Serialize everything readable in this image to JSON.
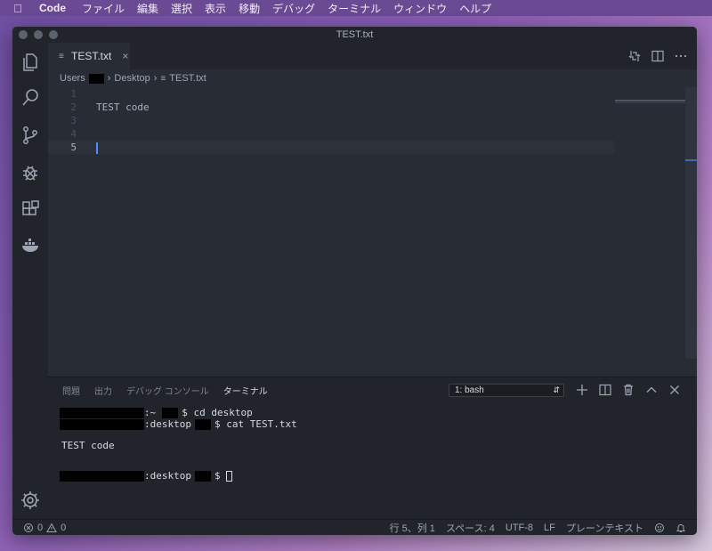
{
  "menubar": {
    "apple_icon": "apple-logo-icon",
    "app_name": "Code",
    "items": [
      "ファイル",
      "編集",
      "選択",
      "表示",
      "移動",
      "デバッグ",
      "ターミナル",
      "ウィンドウ",
      "ヘルプ"
    ]
  },
  "window": {
    "title": "TEST.txt"
  },
  "activity_bar": {
    "icons": [
      "explorer-icon",
      "search-icon",
      "source-control-icon",
      "debug-icon",
      "extensions-icon",
      "docker-icon"
    ],
    "bottom_icon": "gear-icon"
  },
  "tab": {
    "label": "TEST.txt",
    "icon": "text-file-icon",
    "close": "×"
  },
  "tab_actions": [
    "compare-changes-icon",
    "split-editor-icon",
    "more-actions-icon"
  ],
  "breadcrumb": {
    "items": [
      "Users",
      "Desktop",
      "TEST.txt"
    ]
  },
  "editor": {
    "lines": [
      {
        "num": "1",
        "text": ""
      },
      {
        "num": "2",
        "text": "TEST code"
      },
      {
        "num": "3",
        "text": ""
      },
      {
        "num": "4",
        "text": ""
      },
      {
        "num": "5",
        "text": ""
      }
    ],
    "current_line": 5
  },
  "panel": {
    "tabs": [
      "問題",
      "出力",
      "デバッグ コンソール",
      "ターミナル"
    ],
    "active_tab": "ターミナル",
    "terminal_select": "1: bash",
    "actions": [
      "add-icon",
      "split-terminal-icon",
      "trash-icon",
      "chevron-up-icon",
      "close-icon"
    ]
  },
  "terminal": {
    "line1_mid": ":~",
    "line1_cmd": "$ cd desktop",
    "line2_mid": ":desktop",
    "line2_cmd": "$ cat TEST.txt",
    "output": "TEST code",
    "line4_mid": ":desktop",
    "line4_cmd": "$ "
  },
  "statusbar": {
    "errors": "0",
    "warnings": "0",
    "position": "行 5、列 1",
    "spaces": "スペース: 4",
    "encoding": "UTF-8",
    "eol": "LF",
    "language": "プレーンテキスト",
    "icons": [
      "feedback-icon",
      "bell-icon"
    ]
  }
}
